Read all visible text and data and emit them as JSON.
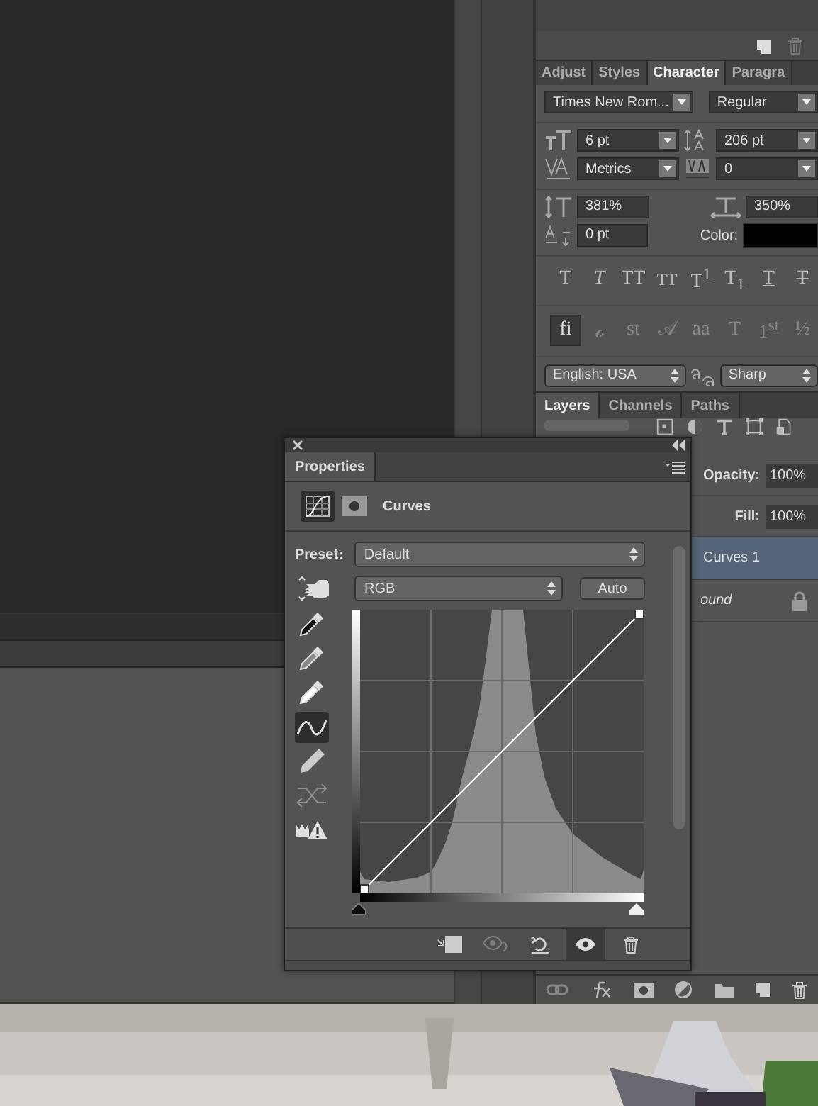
{
  "character_panel": {
    "tabs": [
      {
        "label": "Adjust",
        "selected": false
      },
      {
        "label": "Styles",
        "selected": false
      },
      {
        "label": "Character",
        "selected": true
      },
      {
        "label": "Paragra",
        "selected": false
      }
    ],
    "font_family": "Times New Rom...",
    "font_style": "Regular",
    "size": "6 pt",
    "leading": "206 pt",
    "kerning": "Metrics",
    "tracking": "0",
    "vertical_scale": "381%",
    "horizontal_scale": "350%",
    "baseline_shift": "0 pt",
    "color_label": "Color:",
    "style_buttons": [
      {
        "label": "T",
        "kind": "regular"
      },
      {
        "label": "T",
        "kind": "italic"
      },
      {
        "label": "TT",
        "kind": "allcaps"
      },
      {
        "label": "TT",
        "kind": "smallcaps"
      },
      {
        "label": "T$^{1}$",
        "kind": "superscript"
      },
      {
        "label": "T$_{1}$",
        "kind": "subscript"
      },
      {
        "label": "T",
        "kind": "underline"
      },
      {
        "label": "T",
        "kind": "strike"
      }
    ],
    "opentype_buttons": [
      {
        "label": "fi",
        "selected": true,
        "disabled": false
      },
      {
        "label": "ℴ",
        "selected": false,
        "disabled": true
      },
      {
        "label": "st",
        "selected": false,
        "disabled": true
      },
      {
        "label": "𝒜",
        "selected": false,
        "disabled": true
      },
      {
        "label": "aa",
        "selected": false,
        "disabled": true
      },
      {
        "label": "T",
        "selected": false,
        "disabled": true
      },
      {
        "label": "1$^{st}$",
        "selected": false,
        "disabled": true
      },
      {
        "label": "½",
        "selected": false,
        "disabled": true
      }
    ],
    "language": "English: USA",
    "antialias": "Sharp"
  },
  "layers_panel": {
    "tabs": [
      {
        "label": "Layers",
        "selected": true
      },
      {
        "label": "Channels",
        "selected": false
      },
      {
        "label": "Paths",
        "selected": false
      }
    ],
    "opacity_label": "Opacity:",
    "opacity": "100%",
    "fill_label": "Fill:",
    "fill": "100%",
    "layers": [
      {
        "name": "Curves 1",
        "kind": "adjustment",
        "selected": true,
        "locked": false
      },
      {
        "name": "ound",
        "kind": "background",
        "selected": false,
        "locked": true
      }
    ]
  },
  "properties_panel": {
    "title": "Properties",
    "adjustment": "Curves",
    "preset_label": "Preset:",
    "preset": "Default",
    "channel": "RGB",
    "auto_button": "Auto",
    "tools": [
      {
        "kind": "eyedropper-black",
        "selected": false,
        "disabled": false
      },
      {
        "kind": "eyedropper-gray",
        "selected": false,
        "disabled": false
      },
      {
        "kind": "eyedropper-white",
        "selected": false,
        "disabled": false
      },
      {
        "kind": "curve",
        "selected": true,
        "disabled": false
      },
      {
        "kind": "pencil",
        "selected": false,
        "disabled": false
      },
      {
        "kind": "smooth",
        "selected": false,
        "disabled": true
      },
      {
        "kind": "clipping",
        "selected": false,
        "disabled": false
      }
    ],
    "footer_buttons": [
      {
        "kind": "clip",
        "selected": false,
        "disabled": false
      },
      {
        "kind": "previous",
        "selected": false,
        "disabled": true
      },
      {
        "kind": "reset",
        "selected": false,
        "disabled": false
      },
      {
        "kind": "visibility",
        "selected": true,
        "disabled": false
      },
      {
        "kind": "delete",
        "selected": false,
        "disabled": false
      }
    ]
  }
}
